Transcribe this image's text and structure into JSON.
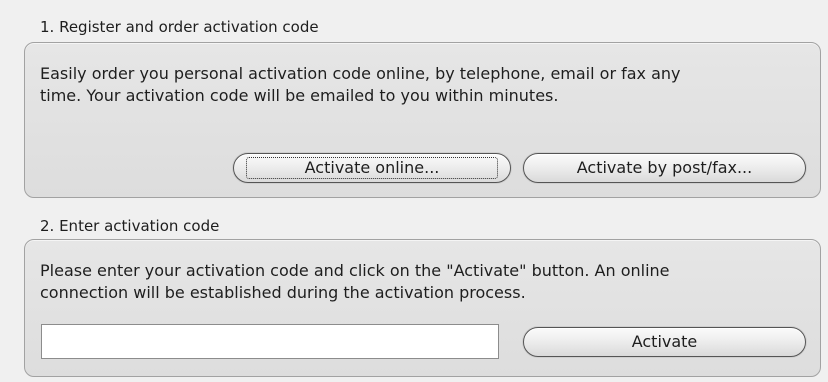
{
  "section1": {
    "title": "1. Register and order activation code",
    "description": "Easily order you personal activation code online, by telephone, email or fax any\ntime. Your activation code will be emailed to you within minutes.",
    "activate_online_label": "Activate online...",
    "activate_post_fax_label": "Activate by post/fax..."
  },
  "section2": {
    "title": "2. Enter activation code",
    "description": "Please enter your activation code and click on the \"Activate\" button. An online\nconnection will be established during the activation process.",
    "code_value": "",
    "activate_label": "Activate"
  }
}
